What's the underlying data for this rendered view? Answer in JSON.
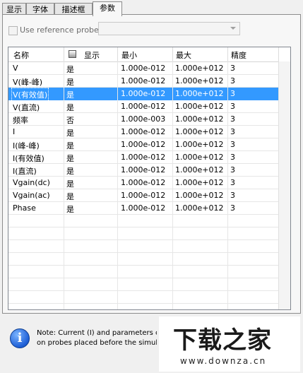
{
  "tabs": [
    {
      "label": "显示"
    },
    {
      "label": "字体"
    },
    {
      "label": "描述框"
    },
    {
      "label": "参数"
    }
  ],
  "reference": {
    "checkbox_label": "Use reference probe",
    "checked": false,
    "combo_value": ""
  },
  "table": {
    "columns": [
      "名称",
      "显示",
      "最小",
      "最大",
      "精度"
    ],
    "rows": [
      {
        "name": "V",
        "show": "是",
        "min": "1.000e-012",
        "max": "1.000e+012",
        "precision": "3"
      },
      {
        "name": "V(峰-峰)",
        "show": "是",
        "min": "1.000e-012",
        "max": "1.000e+012",
        "precision": "3"
      },
      {
        "name": "V(有效值)",
        "show": "是",
        "min": "1.000e-012",
        "max": "1.000e+012",
        "precision": "3"
      },
      {
        "name": "V(直流)",
        "show": "是",
        "min": "1.000e-012",
        "max": "1.000e+012",
        "precision": "3"
      },
      {
        "name": "频率",
        "show": "否",
        "min": "1.000e-003",
        "max": "1.000e+012",
        "precision": "3"
      },
      {
        "name": "I",
        "show": "是",
        "min": "1.000e-012",
        "max": "1.000e+012",
        "precision": "3"
      },
      {
        "name": "I(峰-峰)",
        "show": "是",
        "min": "1.000e-012",
        "max": "1.000e+012",
        "precision": "3"
      },
      {
        "name": "I(有效值)",
        "show": "是",
        "min": "1.000e-012",
        "max": "1.000e+012",
        "precision": "3"
      },
      {
        "name": "I(直流)",
        "show": "是",
        "min": "1.000e-012",
        "max": "1.000e+012",
        "precision": "3"
      },
      {
        "name": "Vgain(dc)",
        "show": "是",
        "min": "1.000e-012",
        "max": "1.000e+012",
        "precision": "3"
      },
      {
        "name": "Vgain(ac)",
        "show": "是",
        "min": "1.000e-012",
        "max": "1.000e+012",
        "precision": "3"
      },
      {
        "name": "Phase",
        "show": "是",
        "min": "1.000e-012",
        "max": "1.000e+012",
        "precision": "3"
      }
    ],
    "selected_index": 2
  },
  "note": {
    "line1": "Note: Current (I) and parameters c",
    "line2": "on probes placed before the simula"
  },
  "watermark": {
    "title": "下载之家",
    "url": "www.downza.cn"
  },
  "colors": {
    "selection": "#3399ff",
    "info_icon": "#1e5fd6"
  }
}
